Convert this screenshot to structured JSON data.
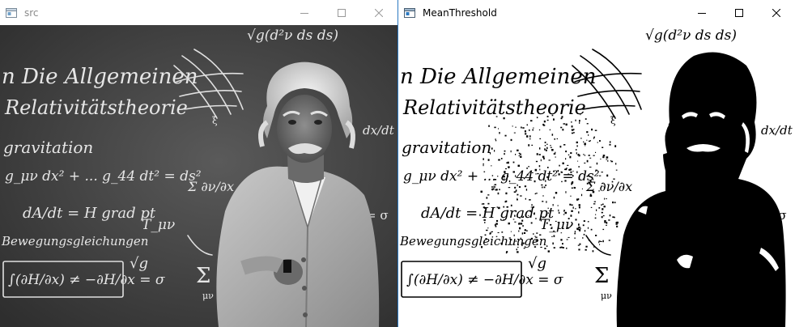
{
  "windows": {
    "src": {
      "title": "src",
      "icons": {
        "app": "window-app-icon",
        "minimize": "minimize-icon",
        "maximize": "maximize-icon",
        "close": "close-icon"
      }
    },
    "mean": {
      "title": "MeanThreshold",
      "icons": {
        "app": "window-app-icon",
        "minimize": "minimize-icon",
        "maximize": "maximize-icon",
        "close": "close-icon"
      }
    }
  },
  "board_text": {
    "line1": "n Die Allgemeinen",
    "line2": "Relativitätstheorie",
    "line3": "gravitation",
    "line4": "g_μν dx² + ... g_44 dt² = ds²",
    "line5": "dA/dt = H grad pt",
    "line6": "Bewegungsgleichungen",
    "line7": "∫(∂H/∂x) ≠ −∂H/∂x = σ",
    "top_formula": "√g(d²ν ds ds)",
    "side_formula": "Σ ∂ν/∂x",
    "right_formula": "dx/dt",
    "sum_sign": "Σ",
    "mu_label": "μν",
    "sigma_label": "= σ",
    "sqrt_label": "√g",
    "tau_label": "T_μν",
    "xi_label": "ξ"
  },
  "colors": {
    "board_dark": "#3c3c3c",
    "board_light": "#5a5a5a",
    "chalk": "#e8e8e8",
    "ink": "#000000",
    "paper": "#ffffff",
    "active_border": "#2b79c2"
  }
}
